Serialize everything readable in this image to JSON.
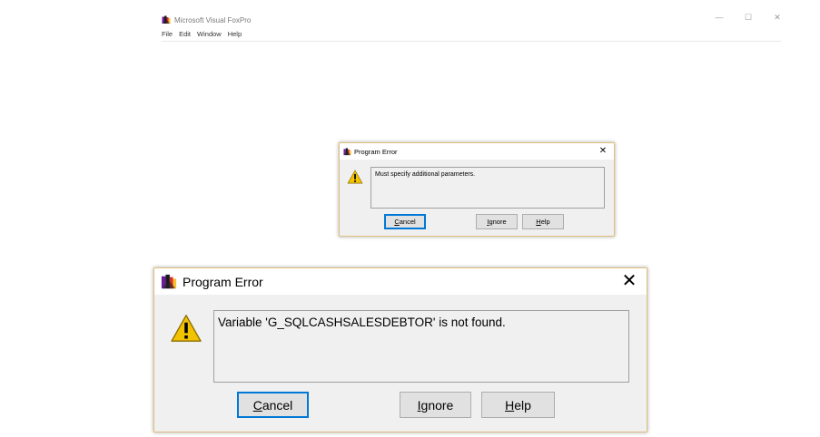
{
  "app": {
    "title": "Microsoft Visual FoxPro",
    "menu": [
      "File",
      "Edit",
      "Window",
      "Help"
    ],
    "controls": {
      "minimize": "—",
      "maximize": "☐",
      "close": "✕"
    }
  },
  "dialogs": [
    {
      "title": "Program Error",
      "close": "✕",
      "message": "Must specify additional parameters.",
      "buttons": {
        "cancel": "Cancel",
        "ignore": "Ignore",
        "help": "Help"
      }
    },
    {
      "title": "Program Error",
      "close": "✕",
      "message": "Variable 'G_SQLCASHSALESDEBTOR' is not found.",
      "buttons": {
        "cancel": "Cancel",
        "ignore": "Ignore",
        "help": "Help"
      }
    }
  ],
  "icons": [
    "foxpro-logo-icon",
    "warning-icon",
    "close-icon"
  ],
  "colors": {
    "dialog_border": "#e0c27c",
    "default_button": "#0078d7",
    "warning_yellow": "#f2c200"
  }
}
